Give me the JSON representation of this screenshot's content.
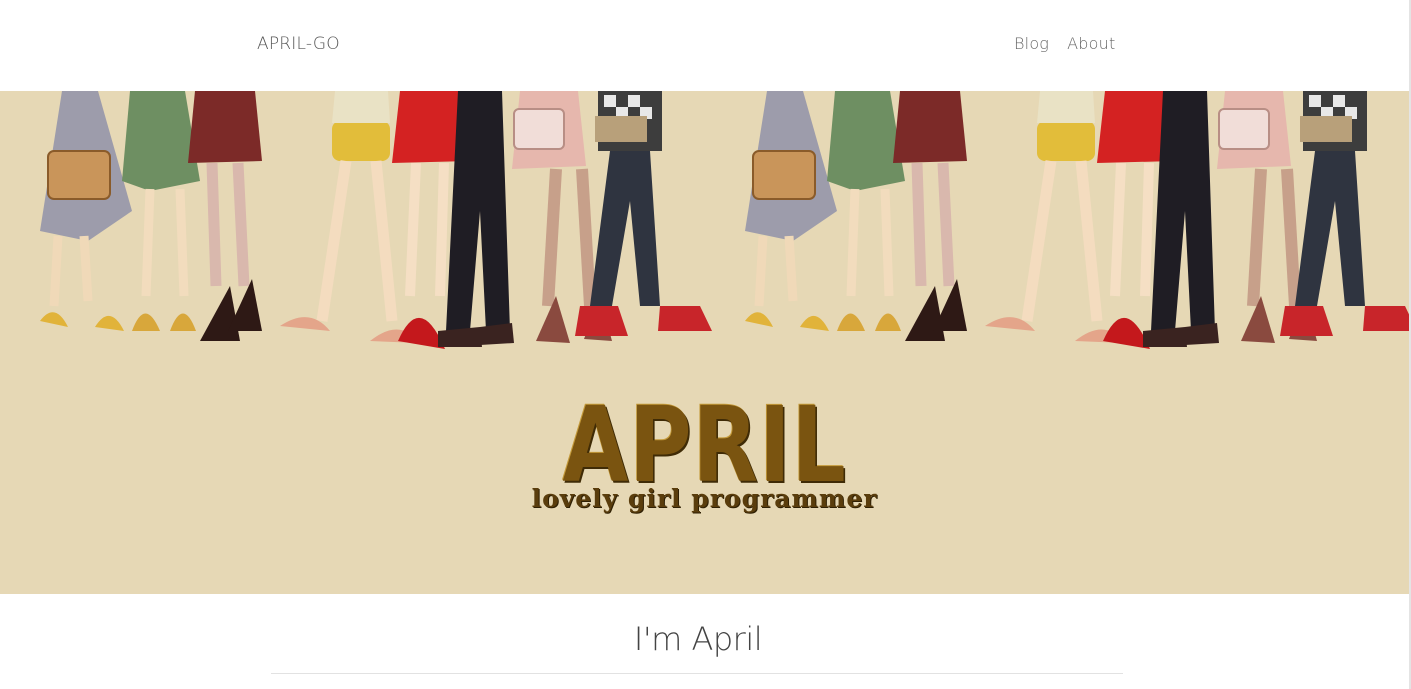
{
  "navbar": {
    "brand": "APRIL-GO",
    "links": [
      "Blog",
      "About"
    ]
  },
  "hero": {
    "title": "APRIL",
    "subtitle": "lovely girl programmer"
  },
  "intro": {
    "heading": "I'm April"
  },
  "colors": {
    "hero_background": "#e6d8b5",
    "title_brown": "#7a5410",
    "subtitle_brown": "#5a3d0c"
  }
}
